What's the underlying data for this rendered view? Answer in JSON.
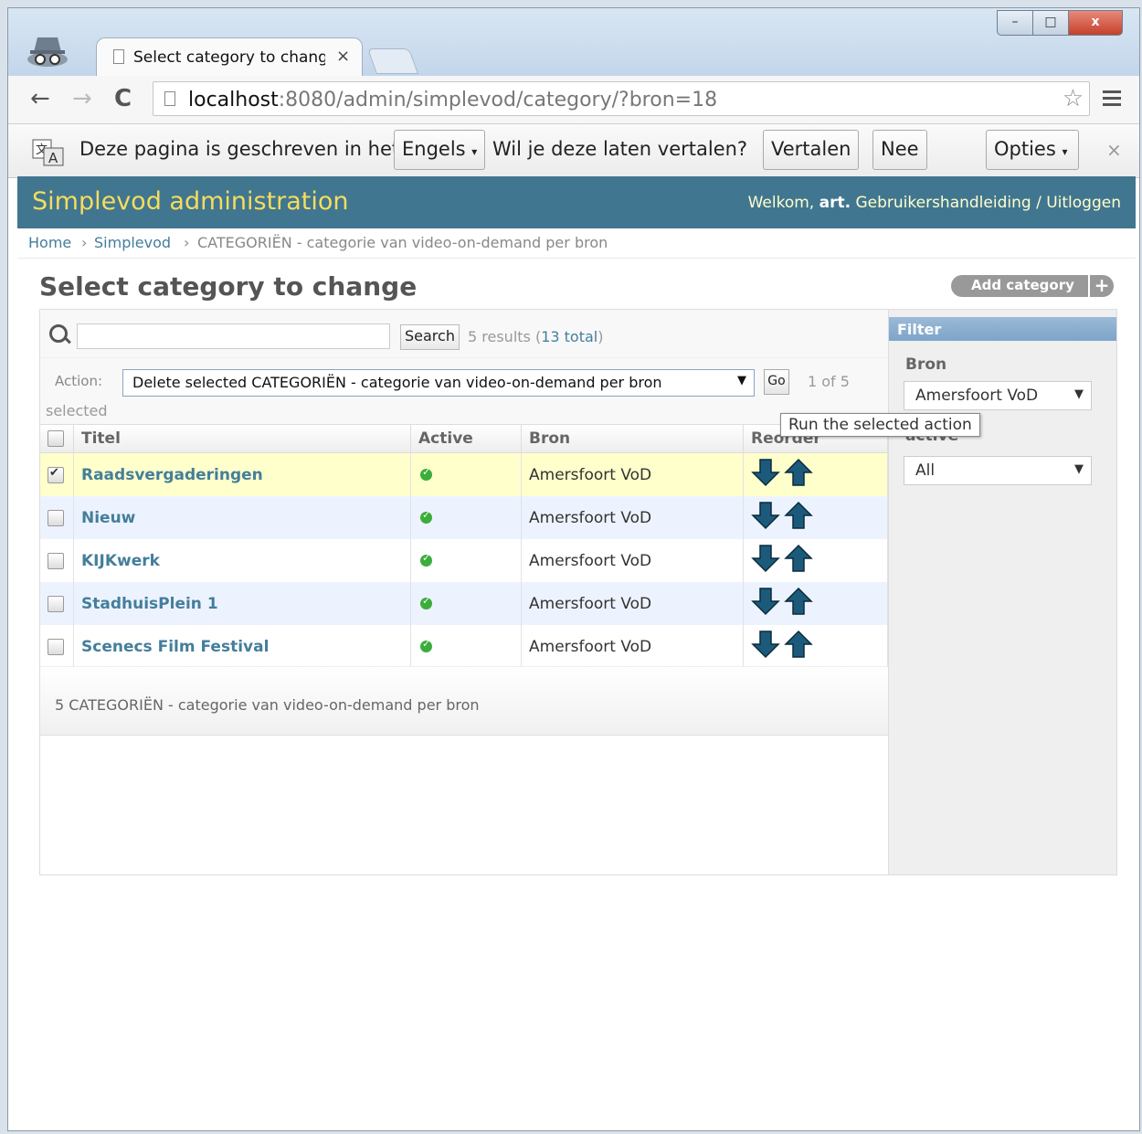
{
  "browser": {
    "tab_title": "Select category to change",
    "tab_close": "×",
    "url_host": "localhost",
    "url_rest": ":8080/admin/simplevod/category/?bron=18",
    "window_min": "–",
    "window_max": "□",
    "window_close": "x"
  },
  "translate_bar": {
    "text_before": "Deze pagina is geschreven in het",
    "language": "Engels",
    "question": "Wil je deze laten vertalen?",
    "translate_button": "Vertalen",
    "no_button": "Nee",
    "options_button": "Opties",
    "close": "×"
  },
  "admin": {
    "brand": "Simplevod administration",
    "welcome": "Welkom,",
    "username": "art.",
    "docs_link": "Gebruikershandleiding",
    "separator": "/",
    "logout_link": "Uitloggen"
  },
  "breadcrumbs": {
    "home": "Home",
    "app": "Simplevod",
    "current": "CATEGORIËN - categorie van video-on-demand per bron",
    "sep": "›"
  },
  "page": {
    "title": "Select category to change",
    "add_button": "Add category",
    "add_plus": "+"
  },
  "search": {
    "button": "Search",
    "results_prefix": "5 results (",
    "results_total": "13 total",
    "results_suffix": ")"
  },
  "actions": {
    "label": "Action:",
    "selected_action": "Delete selected CATEGORIËN - categorie van video-on-demand per bron",
    "go_button": "Go",
    "counter": "1 of 5",
    "selected_label": "selected",
    "tooltip": "Run the selected action"
  },
  "table": {
    "headers": [
      "Titel",
      "Active",
      "Bron",
      "Reorder"
    ],
    "rows": [
      {
        "title": "Raadsvergaderingen",
        "bron": "Amersfoort VoD",
        "checked": true
      },
      {
        "title": "Nieuw",
        "bron": "Amersfoort VoD",
        "checked": false
      },
      {
        "title": "KIJKwerk",
        "bron": "Amersfoort VoD",
        "checked": false
      },
      {
        "title": "StadhuisPlein 1",
        "bron": "Amersfoort VoD",
        "checked": false
      },
      {
        "title": "Scenecs Film Festival",
        "bron": "Amersfoort VoD",
        "checked": false
      }
    ]
  },
  "paginator": {
    "text": "5 CATEGORIËN - categorie van video-on-demand per bron"
  },
  "filter": {
    "heading": "Filter",
    "bron_label": "Bron",
    "bron_value": "Amersfoort VoD",
    "active_label": "active",
    "active_value": "All"
  },
  "colors": {
    "header_bg": "#417690",
    "brand_yellow": "#f5dd5d",
    "link_blue": "#447e9b",
    "arrow_blue": "#1c5a7c"
  }
}
